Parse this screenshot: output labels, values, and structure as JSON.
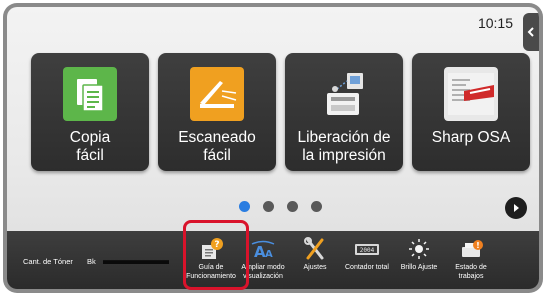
{
  "status": {
    "time": "10:15"
  },
  "apps": [
    {
      "line1": "Copia",
      "line2": "fácil",
      "icon": "copy-icon",
      "color": "#5db64a"
    },
    {
      "line1": "Escaneado",
      "line2": "fácil",
      "icon": "scan-icon",
      "color": "#f0a020"
    },
    {
      "line1": "Liberación de",
      "line2": "la impresión",
      "icon": "print-release-icon",
      "color": "#ffffff"
    },
    {
      "line1": "Sharp OSA",
      "line2": "",
      "icon": "sharp-osa-icon",
      "color": "#e8e8e8"
    }
  ],
  "pagination": {
    "pages": 4,
    "current": 1,
    "active_color": "#2a7de1"
  },
  "toner": {
    "label": "Cant. de Tóner",
    "color": "Bk",
    "level": 1.0
  },
  "taskbar": [
    {
      "label": "Guía de Funcionamiento",
      "icon": "guide-icon",
      "highlighted": true
    },
    {
      "label": "Ampliar modo visualización",
      "icon": "magnify-text-icon"
    },
    {
      "label": "Ajustes",
      "icon": "settings-tools-icon"
    },
    {
      "label": "Contador total",
      "icon": "counter-icon"
    },
    {
      "label": "Brillo Ajuste",
      "icon": "brightness-icon"
    },
    {
      "label": "Estado de trabajos",
      "icon": "job-status-icon"
    }
  ],
  "highlight_color": "#d9132b"
}
